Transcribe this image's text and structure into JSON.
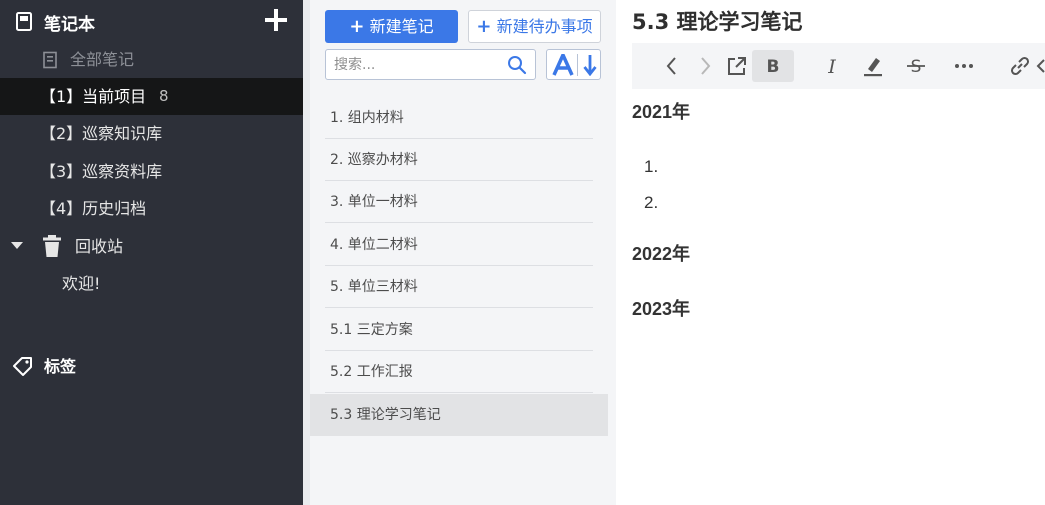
{
  "sidebar": {
    "title": "笔记本",
    "all_notes": "全部笔记",
    "items": [
      {
        "label": "【1】当前项目",
        "count": "8"
      },
      {
        "label": "【2】巡察知识库"
      },
      {
        "label": "【3】巡察资料库"
      },
      {
        "label": "【4】历史归档"
      }
    ],
    "trash": "回收站",
    "welcome": "欢迎!",
    "tags": "标签"
  },
  "notelist": {
    "new_note": "新建笔记",
    "new_todo": "新建待办事项",
    "search_placeholder": "搜索...",
    "notes": [
      "1. 组内材料",
      "2. 巡察办材料",
      "3. 单位一材料",
      "4. 单位二材料",
      "5. 单位三材料",
      "5.1 三定方案",
      "5.2 工作汇报",
      "5.3 理论学习笔记"
    ],
    "selected_index": 7
  },
  "editor": {
    "title": "5.3 理论学习笔记",
    "headings": [
      "2021年",
      "2022年",
      "2023年"
    ],
    "list_items": [
      "1.",
      "2."
    ]
  },
  "colors": {
    "sidebar_bg": "#2d3039",
    "accent": "#3b78e7"
  }
}
